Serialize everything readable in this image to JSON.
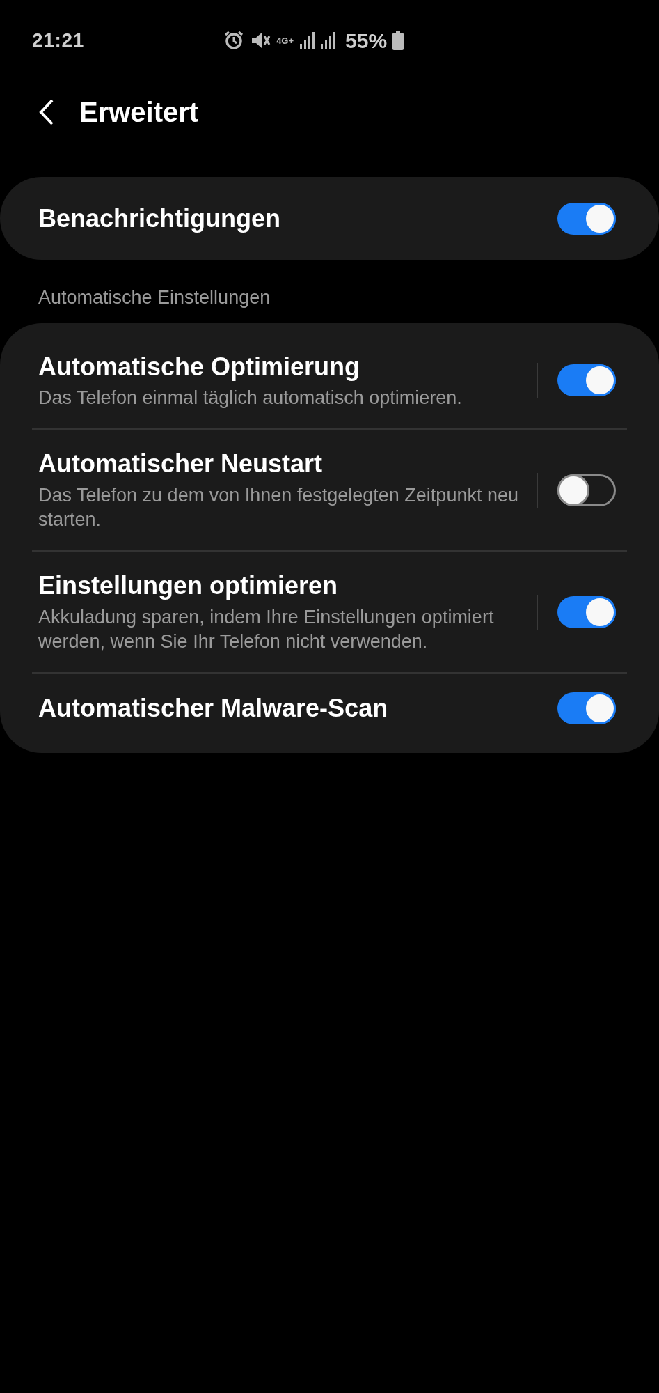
{
  "status_bar": {
    "time": "21:21",
    "network": "4G+",
    "battery": "55%"
  },
  "header": {
    "title": "Erweitert"
  },
  "main_toggle": {
    "label": "Benachrichtigungen",
    "on": true
  },
  "section_label": "Automatische Einstellungen",
  "settings": [
    {
      "title": "Automatische Optimierung",
      "subtitle": "Das Telefon einmal täglich automatisch optimieren.",
      "on": true
    },
    {
      "title": "Automatischer Neustart",
      "subtitle": "Das Telefon zu dem von Ihnen festgelegten Zeitpunkt neu starten.",
      "on": false
    },
    {
      "title": "Einstellungen optimieren",
      "subtitle": "Akkuladung sparen, indem Ihre Einstellungen optimiert werden, wenn Sie Ihr Telefon nicht verwenden.",
      "on": true
    },
    {
      "title": "Automatischer Malware-Scan",
      "on": true
    }
  ]
}
